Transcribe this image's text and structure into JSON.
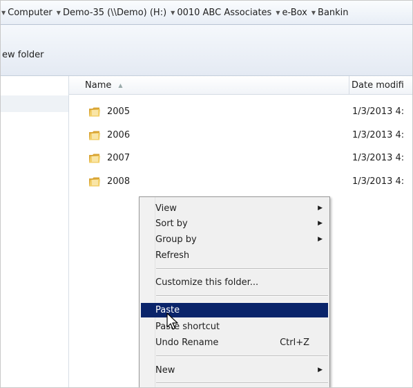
{
  "breadcrumb": {
    "items": [
      "Computer",
      "Demo-35 (\\\\Demo) (H:)",
      "0010 ABC Associates",
      "e-Box",
      "Bankin"
    ]
  },
  "toolbar": {
    "new_folder_label": "ew folder"
  },
  "columns": {
    "name": "Name",
    "date": "Date modifi"
  },
  "files": [
    {
      "name": "2005",
      "date": "1/3/2013 4:"
    },
    {
      "name": "2006",
      "date": "1/3/2013 4:"
    },
    {
      "name": "2007",
      "date": "1/3/2013 4:"
    },
    {
      "name": "2008",
      "date": "1/3/2013 4:"
    }
  ],
  "context_menu": {
    "view": "View",
    "sort_by": "Sort by",
    "group_by": "Group by",
    "refresh": "Refresh",
    "customize": "Customize this folder...",
    "paste": "Paste",
    "paste_shortcut": "Paste shortcut",
    "undo_rename": "Undo Rename",
    "undo_shortcut": "Ctrl+Z",
    "new": "New"
  },
  "colors": {
    "selection": "#0a246a",
    "folder": "#e8b84a"
  }
}
